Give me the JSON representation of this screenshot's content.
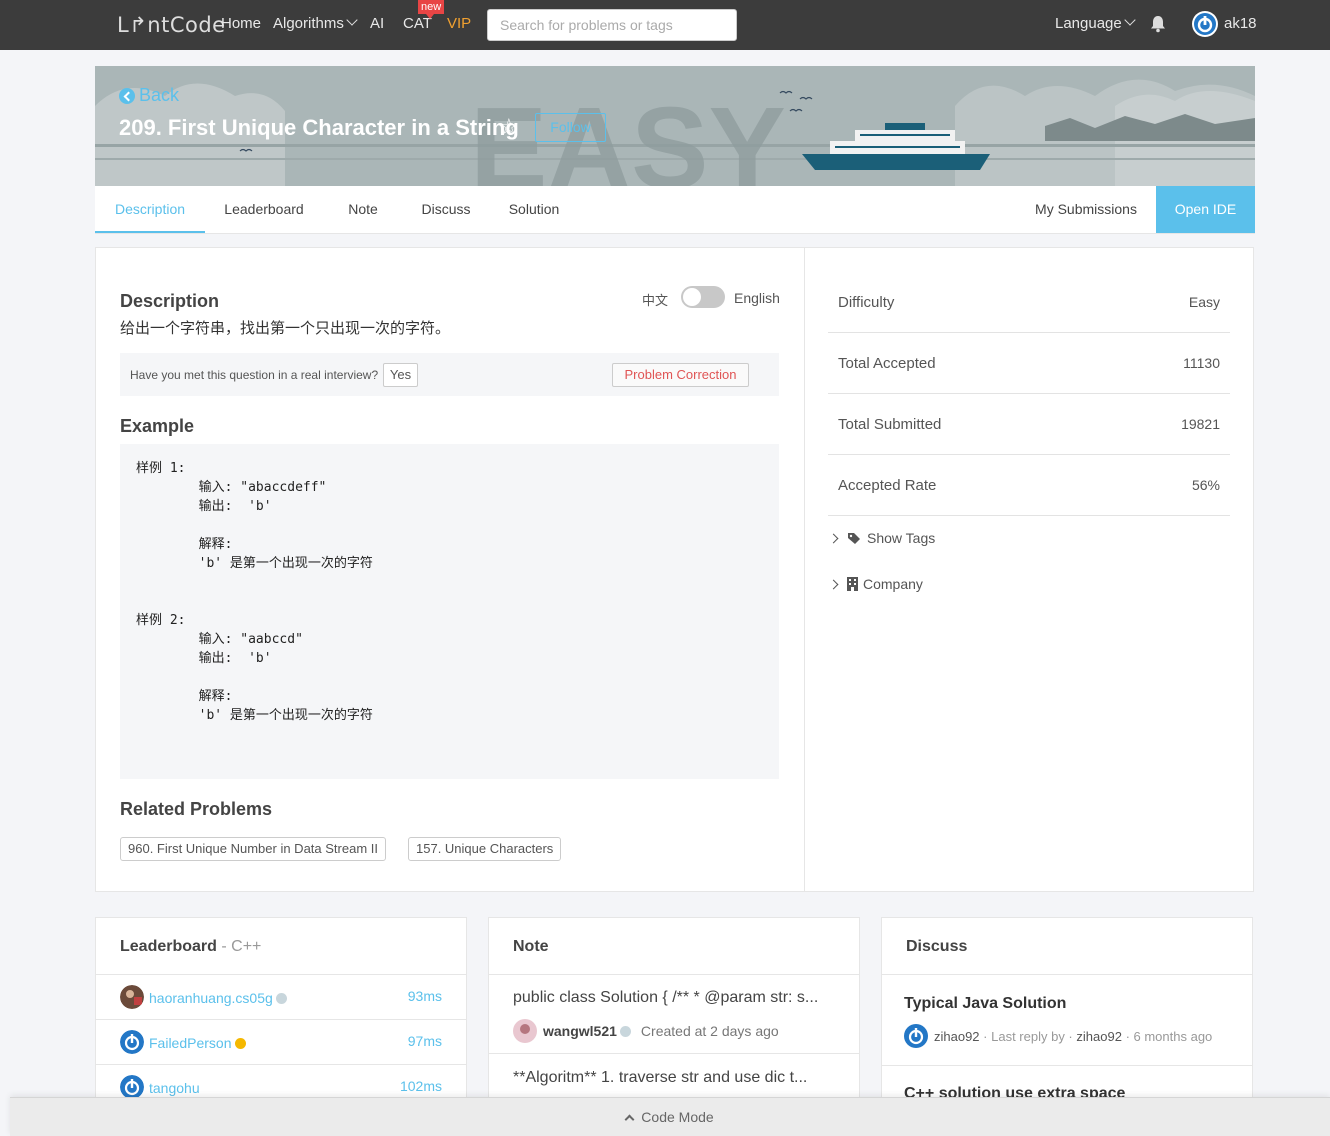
{
  "nav": {
    "logo": "L↱ntCode",
    "home": "Home",
    "algorithms": "Algorithms",
    "ai": "AI",
    "cat": "CAT",
    "new_badge": "new",
    "vip": "VIP",
    "search_placeholder": "Search for problems or tags",
    "language": "Language",
    "username": "ak18"
  },
  "banner": {
    "back": "Back",
    "title": "209. First Unique Character in a String",
    "follow": "Follow",
    "difficulty_watermark": "EASY"
  },
  "tabs": {
    "description": "Description",
    "leaderboard": "Leaderboard",
    "note": "Note",
    "discuss": "Discuss",
    "solution": "Solution",
    "my_submissions": "My Submissions",
    "open_ide": "Open IDE"
  },
  "description": {
    "heading": "Description",
    "lang_zh": "中文",
    "lang_en": "English",
    "text": "给出一个字符串，找出第一个只出现一次的字符。",
    "met_question": "Have you met this question in a real interview?",
    "yes": "Yes",
    "correction": "Problem Correction",
    "example_heading": "Example",
    "example_text": "样例 1:\n\t输入: \"abaccdeff\"\n\t输出:  'b'\n\t\n\t解释:\n\t'b' 是第一个出现一次的字符\n\n\n样例 2:\n\t输入: \"aabccd\"\n\t输出:  'b'\n\t\n\t解释:\n\t'b' 是第一个出现一次的字符",
    "related_heading": "Related Problems",
    "related": [
      "960. First Unique Number in Data Stream II",
      "157. Unique Characters"
    ]
  },
  "stats": {
    "difficulty_label": "Difficulty",
    "difficulty": "Easy",
    "accepted_label": "Total Accepted",
    "accepted": "11130",
    "submitted_label": "Total Submitted",
    "submitted": "19821",
    "rate_label": "Accepted Rate",
    "rate": "56%",
    "show_tags": "Show Tags",
    "company": "Company"
  },
  "leaderboard": {
    "title": "Leaderboard",
    "lang": " - C++",
    "rows": [
      {
        "name": "haoranhuang.cs05g",
        "time": "93ms"
      },
      {
        "name": "FailedPerson",
        "time": "97ms"
      },
      {
        "name": "tangohu",
        "time": "102ms"
      }
    ]
  },
  "note": {
    "title": "Note",
    "items": [
      {
        "text": "public class Solution { /** * @param str: s...",
        "author": "wangwl521",
        "created": "Created at 2 days ago"
      },
      {
        "text": "**Algoritm** 1. traverse str and use dic t..."
      }
    ]
  },
  "discuss": {
    "title": "Discuss",
    "items": [
      {
        "title": "Typical Java Solution",
        "author": "zihao92",
        "last_reply_prefix": "· Last reply by ·",
        "last_reply_by": "zihao92",
        "ago": "· 6 months ago"
      },
      {
        "title": "C++ solution use extra space"
      }
    ]
  },
  "footer": {
    "code_mode": "Code Mode"
  },
  "colors": {
    "accent": "#5bc0eb",
    "nav_bg": "#3c3c3c",
    "vip": "#f0a030"
  }
}
